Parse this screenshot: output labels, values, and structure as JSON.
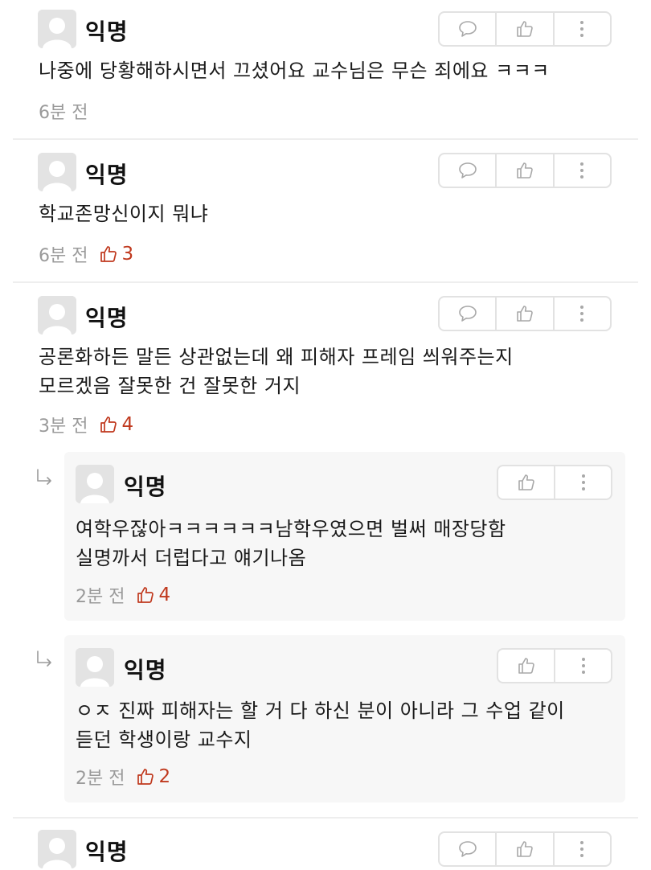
{
  "comments": [
    {
      "author": "익명",
      "text": "나중에 당황해하시면서 끄셨어요 교수님은 무슨 죄에요 ㅋㅋㅋ",
      "time": "6분 전",
      "likes": ""
    },
    {
      "author": "익명",
      "text": "학교존망신이지 뭐냐",
      "time": "6분 전",
      "likes": "3"
    },
    {
      "author": "익명",
      "text": "공론화하든 말든 상관없는데 왜 피해자 프레임 씌워주는지\n모르겠음 잘못한 건 잘못한 거지",
      "time": "3분 전",
      "likes": "4"
    }
  ],
  "replies": [
    {
      "author": "익명",
      "text": "여학우잖아ㅋㅋㅋㅋㅋㅋ남학우였으면 벌써 매장당함\n실명까서 더럽다고 얘기나옴",
      "time": "2분 전",
      "likes": "4"
    },
    {
      "author": "익명",
      "text": "ㅇㅈ 진짜 피해자는 할 거 다 하신 분이 아니라 그 수업 같이\n듣던 학생이랑 교수지",
      "time": "2분 전",
      "likes": "2"
    }
  ],
  "last_comment": {
    "author": "익명"
  },
  "icons": {
    "reply": "speech-bubble-icon",
    "like": "thumbs-up-icon",
    "more": "more-vertical-icon",
    "reply_indicator": "reply-arrow-icon",
    "avatar": "default-avatar-icon"
  },
  "colors": {
    "like_count": "#c0391e",
    "meta_text": "#9a9a9a",
    "reply_background": "#f7f7f7",
    "button_border": "#e2e2e2"
  }
}
